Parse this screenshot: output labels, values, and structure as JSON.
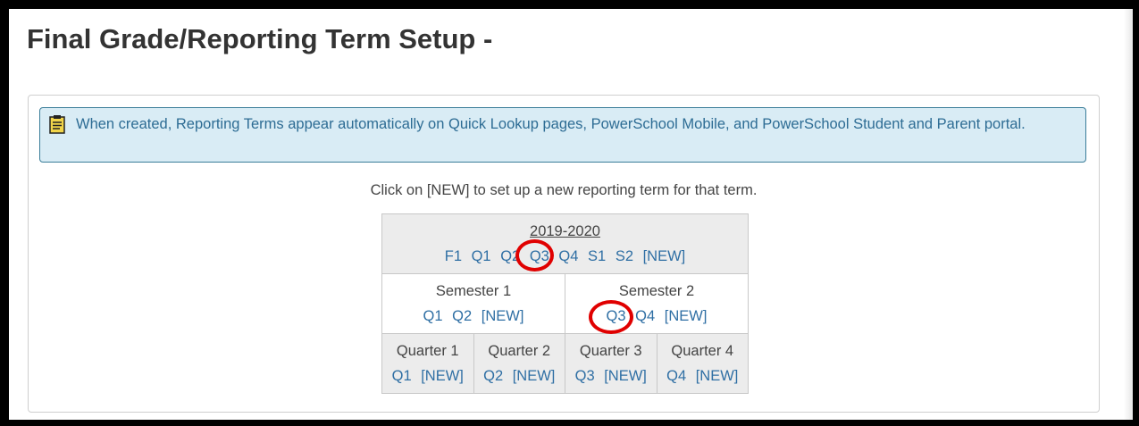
{
  "page": {
    "title": "Final Grade/Reporting Term Setup -"
  },
  "info": {
    "icon": "clipboard-note-icon",
    "message": "When created, Reporting Terms appear automatically on Quick Lookup pages, PowerSchool Mobile, and PowerSchool Student and Parent portal."
  },
  "instruction": "Click on [NEW] to set up a new reporting term for that term.",
  "year": {
    "label": "2019-2020",
    "links": [
      "F1",
      "Q1",
      "Q2",
      "Q3",
      "Q4",
      "S1",
      "S2",
      "[NEW]"
    ]
  },
  "semesters": [
    {
      "label": "Semester 1",
      "links": [
        "Q1",
        "Q2",
        "[NEW]"
      ]
    },
    {
      "label": "Semester 2",
      "links": [
        "Q3",
        "Q4",
        "[NEW]"
      ]
    }
  ],
  "quarters": [
    {
      "label": "Quarter 1",
      "links": [
        "Q1",
        "[NEW]"
      ]
    },
    {
      "label": "Quarter 2",
      "links": [
        "Q2",
        "[NEW]"
      ]
    },
    {
      "label": "Quarter 3",
      "links": [
        "Q3",
        "[NEW]"
      ]
    },
    {
      "label": "Quarter 4",
      "links": [
        "Q4",
        "[NEW]"
      ]
    }
  ],
  "annotations": {
    "highlight_color": "#e00000"
  }
}
